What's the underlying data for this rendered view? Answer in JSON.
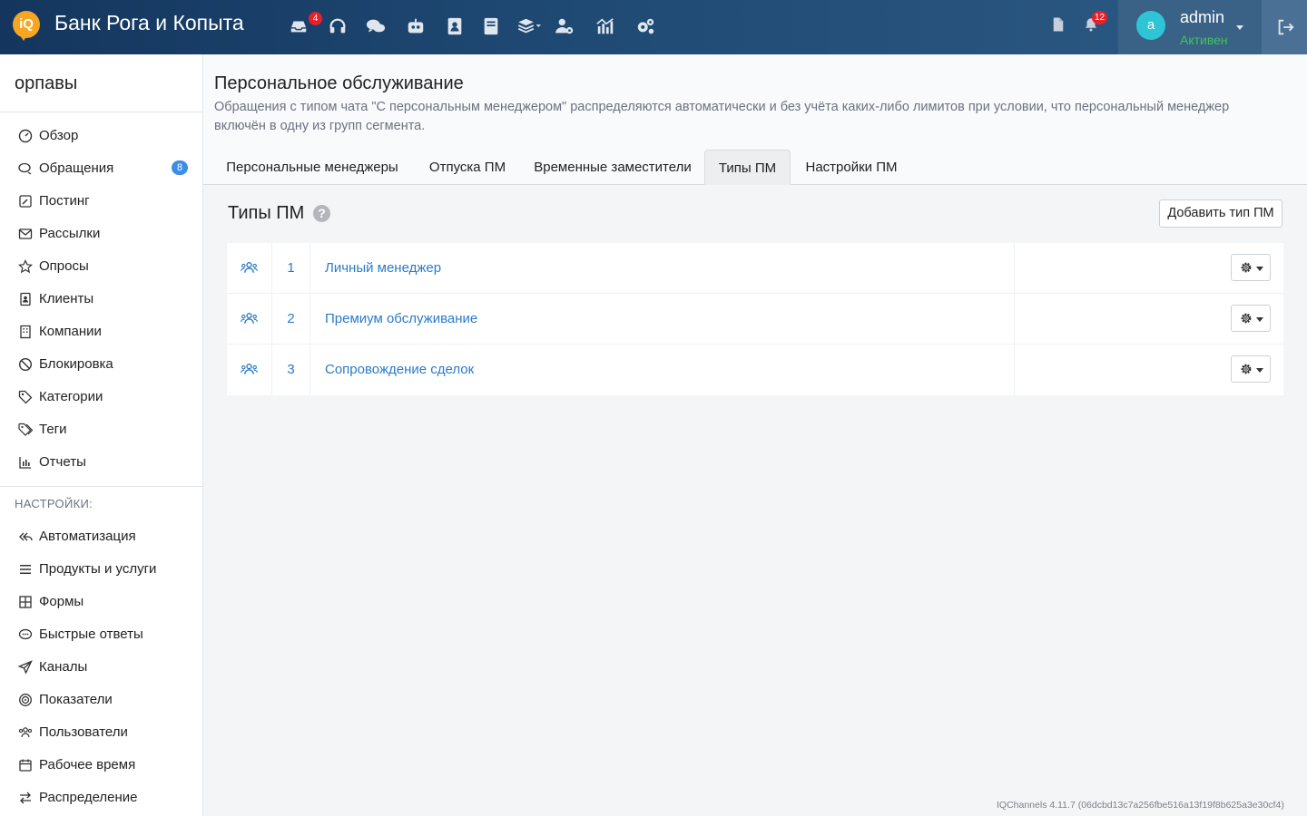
{
  "topbar": {
    "logo_text": "iQ",
    "brand": "Банк Рога и Копыта",
    "icons": [
      {
        "name": "inbox-icon",
        "badge": "4"
      },
      {
        "name": "headset-icon"
      },
      {
        "name": "chat-bubbles-icon"
      },
      {
        "name": "robot-icon"
      },
      {
        "name": "contact-book-icon"
      },
      {
        "name": "book-icon"
      },
      {
        "name": "layers-icon"
      },
      {
        "name": "user-gear-icon"
      },
      {
        "name": "chart-icon"
      },
      {
        "name": "gears-icon"
      }
    ],
    "doc_icon": "document-icon",
    "bell_badge": "12",
    "user": {
      "avatar_letter": "a",
      "name": "admin",
      "status": "Активен"
    },
    "colors": {
      "bar": "#1f4a74",
      "user_area": "#3a6287",
      "badge": "#e8202a",
      "status": "#3ec45a",
      "avatar": "#2ec4d6"
    }
  },
  "sidebar": {
    "title": "орпавы",
    "items": [
      {
        "label": "Обзор",
        "icon": "dashboard-icon"
      },
      {
        "label": "Обращения",
        "icon": "chat-icon",
        "badge": "8"
      },
      {
        "label": "Постинг",
        "icon": "edit-icon"
      },
      {
        "label": "Рассылки",
        "icon": "mail-icon"
      },
      {
        "label": "Опросы",
        "icon": "star-icon"
      },
      {
        "label": "Клиенты",
        "icon": "contact-icon"
      },
      {
        "label": "Компании",
        "icon": "building-icon"
      },
      {
        "label": "Блокировка",
        "icon": "ban-icon"
      },
      {
        "label": "Категории",
        "icon": "tag-icon"
      },
      {
        "label": "Теги",
        "icon": "tags-icon"
      },
      {
        "label": "Отчеты",
        "icon": "bar-chart-icon"
      }
    ],
    "settings_header": "НАСТРОЙКИ:",
    "settings_items": [
      {
        "label": "Автоматизация",
        "icon": "reply-all-icon"
      },
      {
        "label": "Продукты и услуги",
        "icon": "list-icon"
      },
      {
        "label": "Формы",
        "icon": "grid-icon"
      },
      {
        "label": "Быстрые ответы",
        "icon": "comment-icon"
      },
      {
        "label": "Каналы",
        "icon": "paper-plane-icon"
      },
      {
        "label": "Показатели",
        "icon": "target-icon"
      },
      {
        "label": "Пользователи",
        "icon": "users-icon"
      },
      {
        "label": "Рабочее время",
        "icon": "calendar-icon"
      },
      {
        "label": "Распределение",
        "icon": "exchange-icon"
      }
    ]
  },
  "page": {
    "title": "Персональное обслуживание",
    "description": "Обращения с типом чата \"С персональным менеджером\" распределяются автоматически и без учёта каких-либо лимитов при условии, что персональный менеджер включён в одну из групп сегмента.",
    "tabs": [
      {
        "label": "Персональные менеджеры"
      },
      {
        "label": "Отпуска ПМ"
      },
      {
        "label": "Временные заместители"
      },
      {
        "label": "Типы ПМ",
        "active": true
      },
      {
        "label": "Настройки ПМ"
      }
    ]
  },
  "section": {
    "title": "Типы ПМ",
    "help": "?",
    "add_button": "Добавить тип ПМ"
  },
  "table": {
    "rows": [
      {
        "num": "1",
        "name": "Личный менеджер"
      },
      {
        "num": "2",
        "name": "Премиум обслуживание"
      },
      {
        "num": "3",
        "name": "Сопровождение сделок"
      }
    ]
  },
  "footer": {
    "version": "IQChannels 4.11.7 (06dcbd13c7a256fbe516a13f19f8b625a3e30cf4)"
  }
}
